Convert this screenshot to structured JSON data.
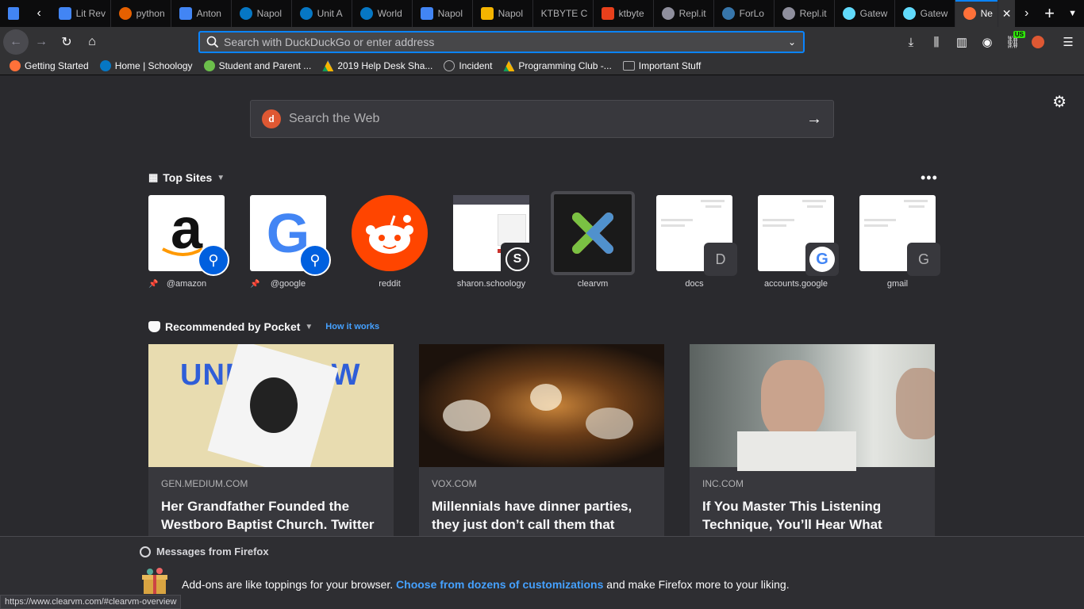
{
  "tabs": [
    {
      "label": "Lit Rev",
      "icon": "docs-icon",
      "color": "#4285f4"
    },
    {
      "label": "python",
      "icon": "python-icon",
      "color": "#e66000"
    },
    {
      "label": "Anton",
      "icon": "docs-icon",
      "color": "#4285f4"
    },
    {
      "label": "Napol",
      "icon": "schoology-icon",
      "color": "#0677c4"
    },
    {
      "label": "Unit A",
      "icon": "schoology-icon",
      "color": "#0677c4"
    },
    {
      "label": "World",
      "icon": "schoology-icon",
      "color": "#0677c4"
    },
    {
      "label": "Napol",
      "icon": "docs-icon",
      "color": "#4285f4"
    },
    {
      "label": "Napol",
      "icon": "slides-icon",
      "color": "#f4b400"
    },
    {
      "label": "KTBYTE C",
      "icon": "",
      "color": ""
    },
    {
      "label": "ktbyte",
      "icon": "ktbyte-icon",
      "color": "#e8401c"
    },
    {
      "label": "Repl.it",
      "icon": "replit-icon",
      "color": "#8f8f9d"
    },
    {
      "label": "ForLo",
      "icon": "python-icon",
      "color": "#3776ab"
    },
    {
      "label": "Repl.it",
      "icon": "replit-icon",
      "color": "#8f8f9d"
    },
    {
      "label": "Gatew",
      "icon": "react-icon",
      "color": "#61dafb"
    },
    {
      "label": "Gatew",
      "icon": "react-icon",
      "color": "#61dafb"
    }
  ],
  "active_tab": {
    "label": "Ne"
  },
  "toolbar": {
    "url_placeholder": "Search with DuckDuckGo or enter address",
    "us_badge": "US"
  },
  "bookmarks": [
    {
      "label": "Getting Started",
      "icon": "firefox-icon",
      "color": "#ff7139"
    },
    {
      "label": "Home | Schoology",
      "icon": "schoology-icon",
      "color": "#0677c4"
    },
    {
      "label": "Student and Parent ...",
      "icon": "powerschool-icon",
      "color": "#6cbf4b"
    },
    {
      "label": "2019 Help Desk Sha...",
      "icon": "drive-icon",
      "color": "#f4b400"
    },
    {
      "label": "Incident",
      "icon": "globe-icon",
      "color": "#b1b1b3"
    },
    {
      "label": "Programming Club -...",
      "icon": "drive-icon",
      "color": "#f4b400"
    },
    {
      "label": "Important Stuff",
      "icon": "folder-icon",
      "color": "#b1b1b3"
    }
  ],
  "websearch": {
    "placeholder": "Search the Web"
  },
  "top_sites": {
    "heading": "Top Sites",
    "items": [
      {
        "label": "@amazon",
        "pinned": true
      },
      {
        "label": "@google",
        "pinned": true
      },
      {
        "label": "reddit",
        "pinned": false
      },
      {
        "label": "sharon.schoology",
        "pinned": false
      },
      {
        "label": "clearvm",
        "pinned": false
      },
      {
        "label": "docs",
        "pinned": false,
        "letter": "D"
      },
      {
        "label": "accounts.google",
        "pinned": false
      },
      {
        "label": "gmail",
        "pinned": false,
        "letter": "G"
      }
    ]
  },
  "pocket": {
    "heading": "Recommended by Pocket",
    "how_link": "How it works",
    "cards": [
      {
        "source": "GEN.MEDIUM.COM",
        "title": "Her Grandfather Founded the Westboro Baptist Church. Twitter Helped Her Leave It",
        "image_text": "UNFOLLOW"
      },
      {
        "source": "VOX.COM",
        "title": "Millennials have dinner parties, they just don’t call them that"
      },
      {
        "source": "INC.COM",
        "title": "If You Master This Listening Technique, You’ll Hear What People Don’t Say Out Loud"
      }
    ]
  },
  "messages": {
    "heading": "Messages from Firefox",
    "text_before": "Add-ons are like toppings for your browser. ",
    "link": "Choose from dozens of customizations",
    "text_after": " and make Firefox more to your liking."
  },
  "status_url": "https://www.clearvm.com/#clearvm-overview"
}
